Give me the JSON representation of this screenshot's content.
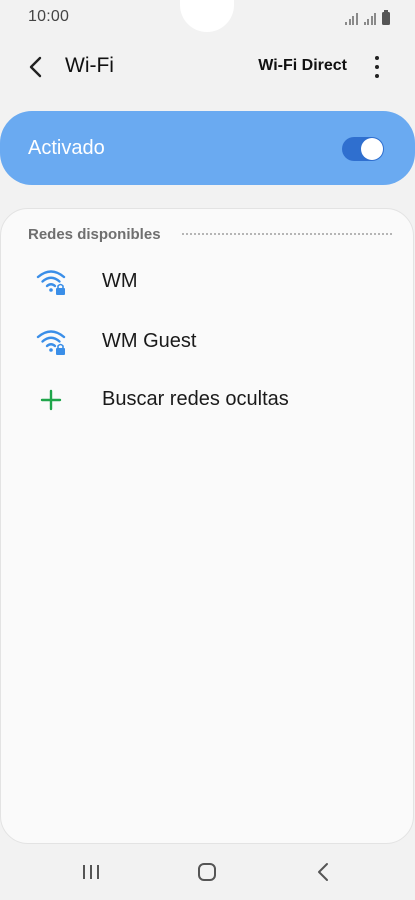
{
  "status_bar": {
    "time": "10:00",
    "icons": [
      "signal-icon",
      "signal-icon",
      "battery-icon"
    ]
  },
  "header": {
    "title": "Wi-Fi",
    "back_icon": "chevron-left-icon",
    "wifi_direct_label": "Wi-Fi Direct",
    "more_icon": "more-vertical-icon"
  },
  "master_toggle": {
    "label": "Activado",
    "state": true,
    "card_color": "#6aaaf1",
    "switch_color": "#2f6fcf"
  },
  "networks_section": {
    "title": "Redes disponibles",
    "items": [
      {
        "label": "WM",
        "icon": "wifi-locked-icon"
      },
      {
        "label": "WM Guest",
        "icon": "wifi-locked-icon"
      },
      {
        "label": "Buscar redes ocultas",
        "icon": "plus-icon"
      }
    ],
    "wifi_icon_color": "#3a8ee8",
    "plus_icon_color": "#1fa54a"
  },
  "nav_bar": {
    "icons": [
      "recents-icon",
      "home-icon",
      "back-icon"
    ]
  }
}
